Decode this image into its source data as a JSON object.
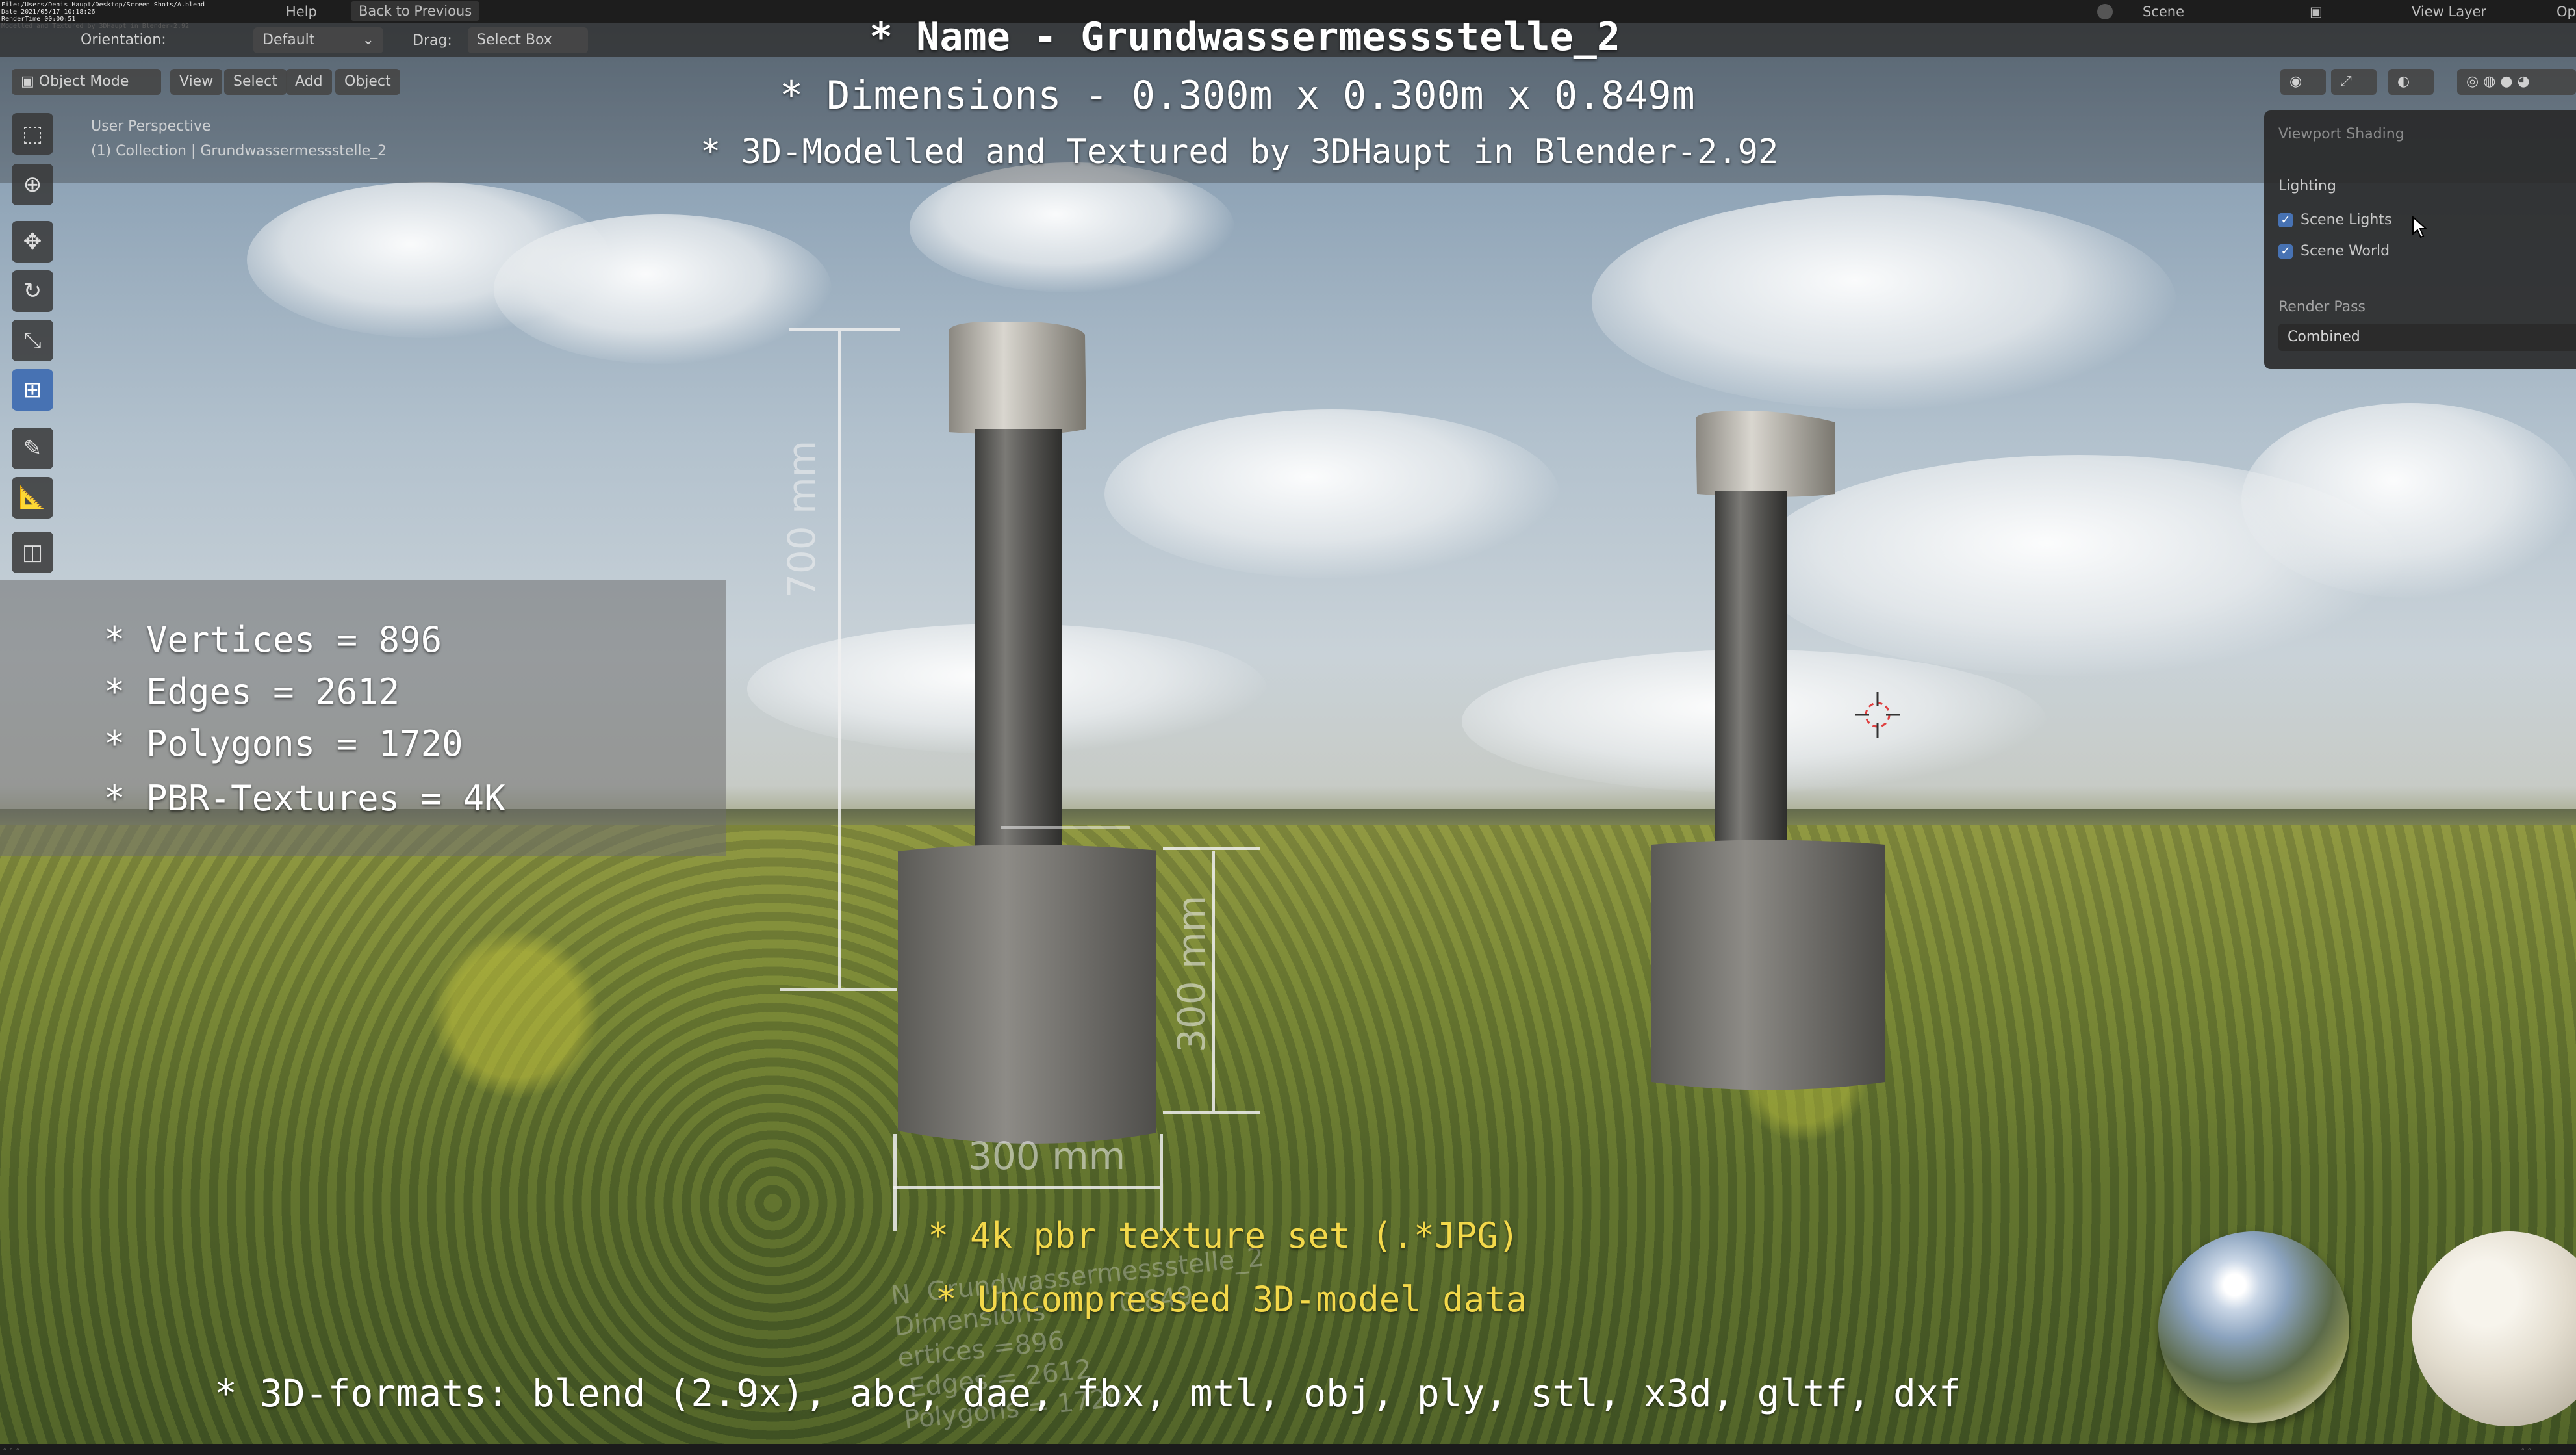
{
  "topbar": {
    "menu_items": [
      "Help"
    ],
    "back_button": "Back to Previous",
    "scene": "Scene",
    "view_layer": "View Layer",
    "opt": "Opt"
  },
  "header": {
    "orientation": "Orientation:",
    "transform": "Default",
    "drag_label": "Drag:",
    "drag_value": "Select Box",
    "mode": "Object Mode",
    "menus": [
      "View",
      "Select",
      "Add",
      "Object"
    ]
  },
  "viewport": {
    "perspective": "User Perspective",
    "collection": "(1) Collection | Grundwassermessstelle_2"
  },
  "overlay": {
    "name": "* Name - Grundwassermessstelle_2",
    "dimensions": "* Dimensions -  0.300m x 0.300m x 0.849m",
    "credits": "* 3D-Modelled and Textured by 3DHaupt in Blender-2.92",
    "stats": [
      "* Vertices = 896",
      "* Edges = 2612",
      "* Polygons = 1720",
      "* PBR-Textures = 4K"
    ],
    "texture_line": "* 4k pbr texture set (.*JPG)",
    "uncompressed_line": "* Uncompressed 3D-model data",
    "formats_line": "* 3D-formats: blend (2.9x), abc, dae, fbx, mtl, obj, ply, stl, x3d, gltf, dxf"
  },
  "measurements": {
    "height": "700 mm",
    "base_height": "300 mm",
    "base_width": "300 mm"
  },
  "shading_panel": {
    "title": "Viewport Shading",
    "lighting": "Lighting",
    "scene_lights": "Scene Lights",
    "scene_world": "Scene World",
    "render_pass_label": "Render Pass",
    "render_pass_value": "Combined"
  },
  "colors": {
    "accent": "#4772b3",
    "overlay_text": "#ffffff",
    "yellow_text": "#f3d84a"
  }
}
